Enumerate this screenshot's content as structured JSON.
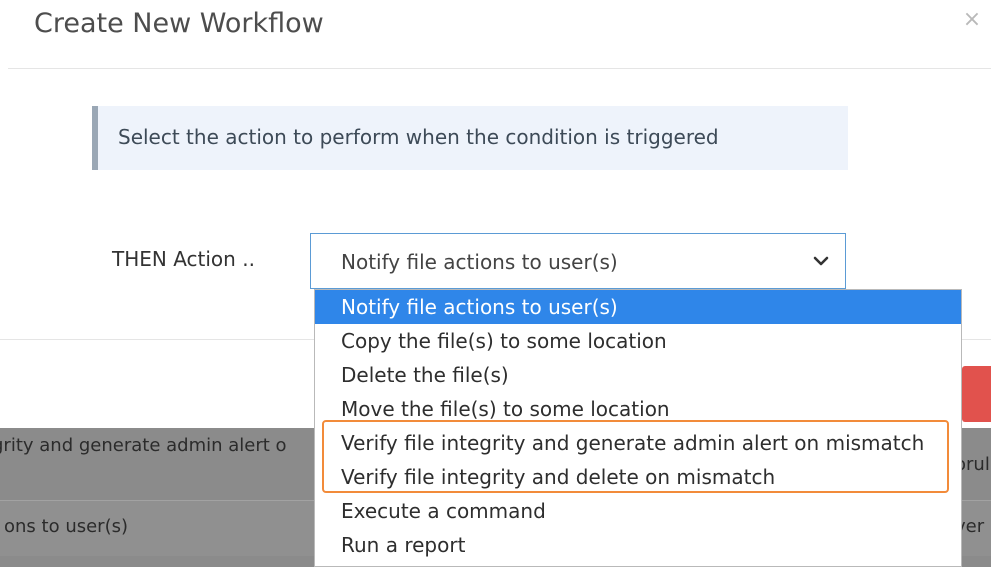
{
  "dialog": {
    "title": "Create New Workflow",
    "close_icon": "×"
  },
  "callout": {
    "text": "Select the action to perform when the condition is triggered"
  },
  "action": {
    "label": "THEN Action ..",
    "selected": "Notify file actions to user(s)"
  },
  "dropdown": {
    "options": [
      "Notify file actions to user(s)",
      "Copy the file(s) to some location",
      "Delete the file(s)",
      "Move the file(s) to some location",
      "Verify file integrity and generate admin alert on mismatch",
      "Verify file integrity and delete on mismatch",
      "Execute a command",
      "Run a report"
    ],
    "selected_index": 0,
    "highlighted_options": [
      4,
      5
    ]
  },
  "background_table": {
    "row1_left": "grity and generate admin alert o",
    "row1_right": "orul",
    "row2_left": "ons to user(s)",
    "row2_right": "ver"
  },
  "colors": {
    "selected_option": "#2f86e9",
    "highlight_border": "#f28b3a",
    "delete_button": "#e1524d"
  }
}
